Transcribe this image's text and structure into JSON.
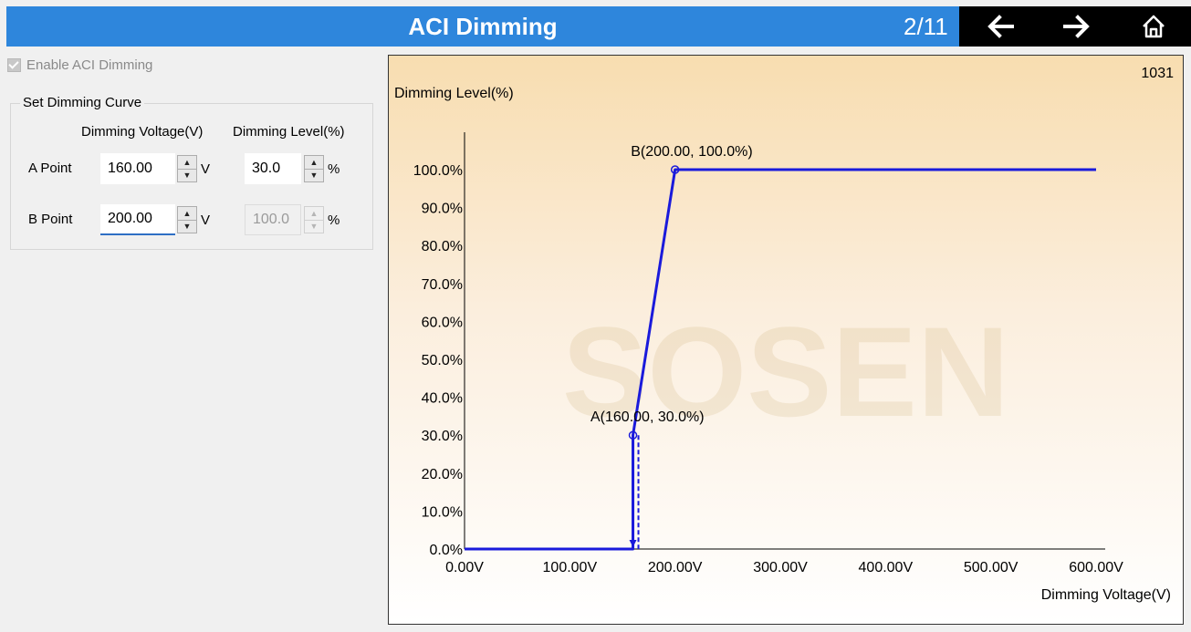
{
  "header": {
    "title": "ACI Dimming",
    "page_indicator": "2/11",
    "nav": {
      "back_icon": "arrow-left-icon",
      "forward_icon": "arrow-right-icon",
      "home_icon": "home-icon"
    }
  },
  "left_panel": {
    "enable_label": "Enable ACI Dimming",
    "enable_checked": true,
    "group_title": "Set Dimming Curve",
    "col_voltage": "Dimming Voltage(V)",
    "col_level": "Dimming Level(%)",
    "unit_v": "V",
    "unit_pct": "%",
    "point_a": {
      "label": "A Point",
      "voltage": "160.00",
      "level": "30.0"
    },
    "point_b": {
      "label": "B Point",
      "voltage": "200.00",
      "level": "100.0"
    }
  },
  "watermark": "SOSEN",
  "colors": {
    "title_bar": "#2e86dc",
    "curve": "#1a1adb",
    "nav_bg": "#000000"
  },
  "chart_data": {
    "type": "line",
    "corner_value": "1031",
    "ylabel": "Dimming Level(%)",
    "xlabel": "Dimming Voltage(V)",
    "xlim": [
      0,
      600
    ],
    "ylim": [
      0,
      100
    ],
    "x_ticks": [
      "0.00V",
      "100.00V",
      "200.00V",
      "300.00V",
      "400.00V",
      "500.00V",
      "600.00V"
    ],
    "y_ticks": [
      "0.0%",
      "10.0%",
      "20.0%",
      "30.0%",
      "40.0%",
      "50.0%",
      "60.0%",
      "70.0%",
      "80.0%",
      "90.0%",
      "100.0%"
    ],
    "series": [
      {
        "x": [
          0,
          160,
          160,
          200,
          600
        ],
        "y": [
          0,
          0,
          30,
          100,
          100
        ]
      }
    ],
    "points": [
      {
        "label": "A(160.00, 30.0%)",
        "x": 160,
        "y": 30
      },
      {
        "label": "B(200.00, 100.0%)",
        "x": 200,
        "y": 100
      }
    ]
  }
}
